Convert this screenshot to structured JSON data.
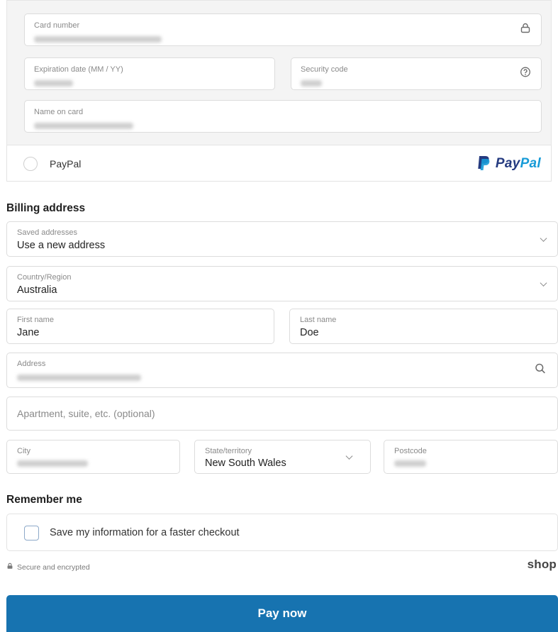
{
  "card": {
    "card_number_label": "Card number",
    "expiration_label": "Expiration date (MM / YY)",
    "security_code_label": "Security code",
    "name_on_card_label": "Name on card"
  },
  "paypal": {
    "label": "PayPal",
    "logo_pay": "Pay",
    "logo_pal": "Pal"
  },
  "billing": {
    "title": "Billing address",
    "saved_addresses_label": "Saved addresses",
    "saved_addresses_value": "Use a new address",
    "country_label": "Country/Region",
    "country_value": "Australia",
    "first_name_label": "First name",
    "first_name_value": "Jane",
    "last_name_label": "Last name",
    "last_name_value": "Doe",
    "address_label": "Address",
    "apartment_placeholder": "Apartment, suite, etc. (optional)",
    "city_label": "City",
    "state_label": "State/territory",
    "state_value": "New South Wales",
    "postcode_label": "Postcode"
  },
  "remember": {
    "title": "Remember me",
    "checkbox_label": "Save my information for a faster checkout"
  },
  "footer": {
    "secure_text": "Secure and encrypted",
    "shop_logo": "shop",
    "pay_button": "Pay now"
  },
  "colors": {
    "primary": "#1773b0",
    "paypal_dark": "#253b80",
    "paypal_light": "#179bd7"
  }
}
